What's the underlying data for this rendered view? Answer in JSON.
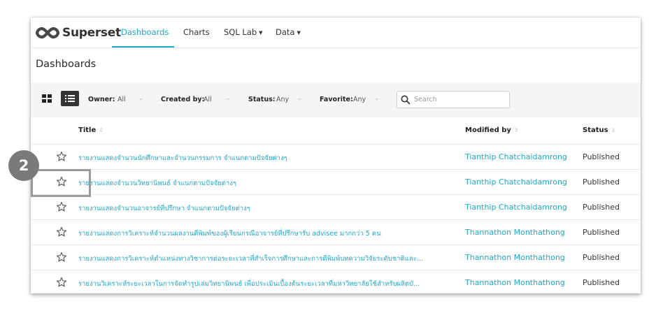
{
  "navbar": {
    "brand": "Superset",
    "items": [
      {
        "label": "Dashboards",
        "active": true
      },
      {
        "label": "Charts",
        "active": false
      },
      {
        "label": "SQL Lab",
        "active": false,
        "dropdown": true
      },
      {
        "label": "Data",
        "active": false,
        "dropdown": true
      }
    ],
    "caret": "▼"
  },
  "page": {
    "title": "Dashboards"
  },
  "filters": {
    "owner": {
      "label": "Owner:",
      "value": "All"
    },
    "created_by": {
      "label": "Created by:",
      "value": "All"
    },
    "status": {
      "label": "Status:",
      "value": "Any"
    },
    "favorite": {
      "label": "Favorite:",
      "value": "Any"
    },
    "search_placeholder": "Search",
    "caret": "⌄"
  },
  "table": {
    "headers": {
      "title": "Title",
      "modified_by": "Modified by",
      "status": "Status"
    },
    "sort_glyph": "⇕",
    "rows": [
      {
        "title": "รายงานแสดงจำนวนนักศึกษาและจำนวนกรรมการ จำแนกตามปัจจัยต่างๆ",
        "modified_by": "Tianthip Chatchaidamrong",
        "status": "Published"
      },
      {
        "title": "รายงานแสดงจำนวนวิทยานิพนธ์ จำแนกตามปัจจัยต่างๆ",
        "modified_by": "Tianthip Chatchaidamrong",
        "status": "Published"
      },
      {
        "title": "รายงานแสดงจำนวนอาจารย์ที่ปรึกษา จำแนกตามปัจจัยต่างๆ",
        "modified_by": "Tianthip Chatchaidamrong",
        "status": "Published"
      },
      {
        "title": "รายงานแสดงการวิเคราะห์จำนวนผลงานตีพิมพ์ของผู้เรียนกรณีอาจารย์ที่ปรึกษารับ advisee มากกว่า 5 คน",
        "modified_by": "Thannathon Monthathong",
        "status": "Published"
      },
      {
        "title": "รายงานแสดงการวิเคราะห์ตำแหน่งทางวิชาการต่อระยะเวลาที่สำเร็จการศึกษาและการตีพิมพ์บทความวิจัยระดับชาติและ...",
        "modified_by": "Thannathon Monthathong",
        "status": "Published"
      },
      {
        "title": "รายงานวิเคราะห์ระยะเวลาในการจัดทำรูปเล่มวิทยานิพนธ์ เพื่อประเมินเบื้องต้นระยะเวลาที่มหาวิทยาลัยใช้สำหรับผลิตบั...",
        "modified_by": "Thannathon Monthathong",
        "status": "Published"
      }
    ]
  },
  "annotation": {
    "step_number": "2"
  },
  "colors": {
    "accent": "#20a7c9",
    "text": "#1f1f1f",
    "filter_bg": "#f5f5f5",
    "badge": "#7a7a7a"
  }
}
